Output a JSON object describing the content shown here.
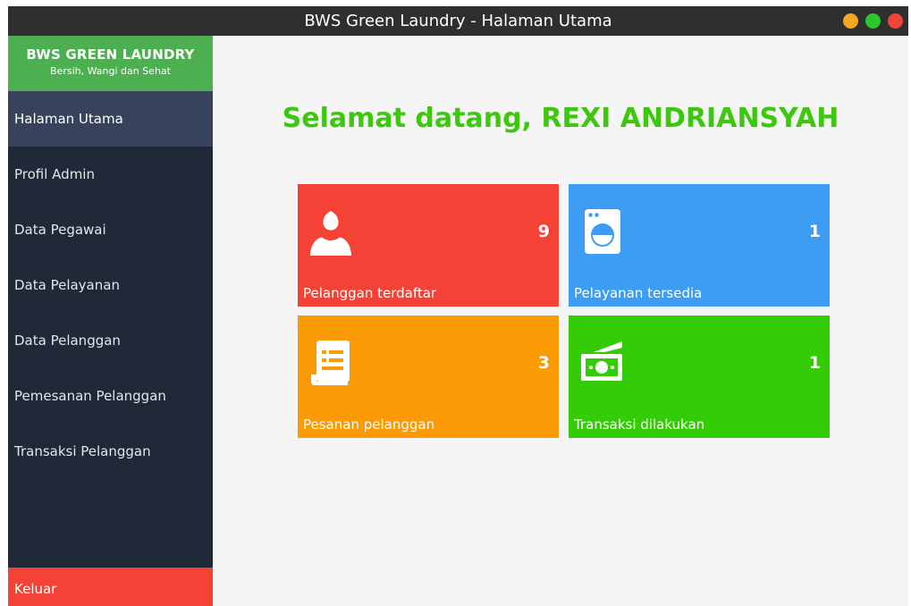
{
  "window": {
    "title": "BWS Green  Laundry -  Halaman Utama",
    "controls": [
      "minimize",
      "maximize",
      "close"
    ]
  },
  "colors": {
    "titlebar": "#2f2f2f",
    "sidebar": "#202938",
    "sidebar_active": "#36435a",
    "brand": "#4caf50",
    "logout": "#f44336",
    "welcome_text": "#3ec70f",
    "tile_customers": "#f44336",
    "tile_services": "#3d9df2",
    "tile_orders": "#fb9a05",
    "tile_transactions": "#33cc07",
    "dot_minimize": "#f5a623",
    "dot_maximize": "#2ec42f",
    "dot_close": "#f34336"
  },
  "sidebar": {
    "brand_name": "BWS GREEN LAUNDRY",
    "brand_tagline": "Bersih, Wangi dan Sehat",
    "items": [
      {
        "label": "Halaman Utama",
        "active": true
      },
      {
        "label": "Profil Admin"
      },
      {
        "label": "Data Pegawai"
      },
      {
        "label": "Data Pelayanan"
      },
      {
        "label": "Data Pelanggan"
      },
      {
        "label": "Pemesanan Pelanggan"
      },
      {
        "label": "Transaksi Pelanggan"
      }
    ],
    "logout_label": "Keluar"
  },
  "main": {
    "welcome": "Selamat datang, REXI ANDRIANSYAH",
    "tiles": [
      {
        "icon": "user-icon",
        "count": "9",
        "label": "Pelanggan terdaftar"
      },
      {
        "icon": "washing-machine-icon",
        "count": "1",
        "label": "Pelayanan tersedia"
      },
      {
        "icon": "receipt-icon",
        "count": "3",
        "label": "Pesanan pelanggan"
      },
      {
        "icon": "cash-icon",
        "count": "1",
        "label": "Transaksi dilakukan"
      }
    ]
  }
}
